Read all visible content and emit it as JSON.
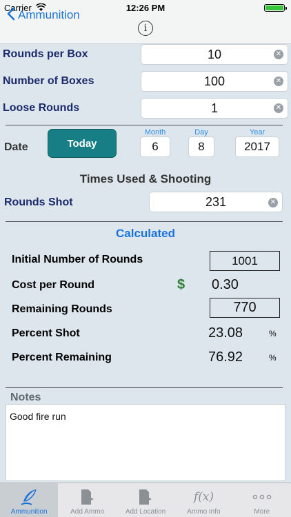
{
  "status_bar": {
    "carrier": "Carrier",
    "time": "12:26 PM"
  },
  "nav": {
    "back_label": "Ammunition",
    "info_icon": "info-icon"
  },
  "fields": {
    "rounds_per_box": {
      "label": "Rounds per Box",
      "value": "10"
    },
    "number_of_boxes": {
      "label": "Number of Boxes",
      "value": "100"
    },
    "loose_rounds": {
      "label": "Loose Rounds",
      "value": "1"
    }
  },
  "date": {
    "label": "Date",
    "today_button": "Today",
    "month_caption": "Month",
    "month": "6",
    "day_caption": "Day",
    "day": "8",
    "year_caption": "Year",
    "year": "2017"
  },
  "times_used": {
    "title": "Times Used & Shooting",
    "rounds_shot_label": "Rounds Shot",
    "rounds_shot": "231"
  },
  "calculated": {
    "title": "Calculated",
    "initial_label": "Initial Number of Rounds",
    "initial_value": "1001",
    "cost_label": "Cost per Round",
    "currency": "$",
    "cost_value": "0.30",
    "remaining_label": "Remaining Rounds",
    "remaining_value": "770",
    "percent_shot_label": "Percent Shot",
    "percent_shot": "23.08",
    "percent_remaining_label": "Percent Remaining",
    "percent_remaining": "76.92",
    "percent_sign": "%"
  },
  "notes": {
    "label": "Notes",
    "text": "Good fire run"
  },
  "tabs": [
    {
      "label": "Ammunition",
      "icon": "feather-icon",
      "active": true
    },
    {
      "label": "Add Ammo",
      "icon": "document-add-icon",
      "active": false
    },
    {
      "label": "Add Location",
      "icon": "document-add-icon",
      "active": false
    },
    {
      "label": "Ammo Info",
      "icon": "function-icon",
      "active": false
    },
    {
      "label": "More",
      "icon": "more-icon",
      "active": false
    }
  ],
  "colors": {
    "accent": "#1a73d9",
    "today_button": "#177e85",
    "currency": "#2e7d32",
    "background": "#dde6ec"
  }
}
